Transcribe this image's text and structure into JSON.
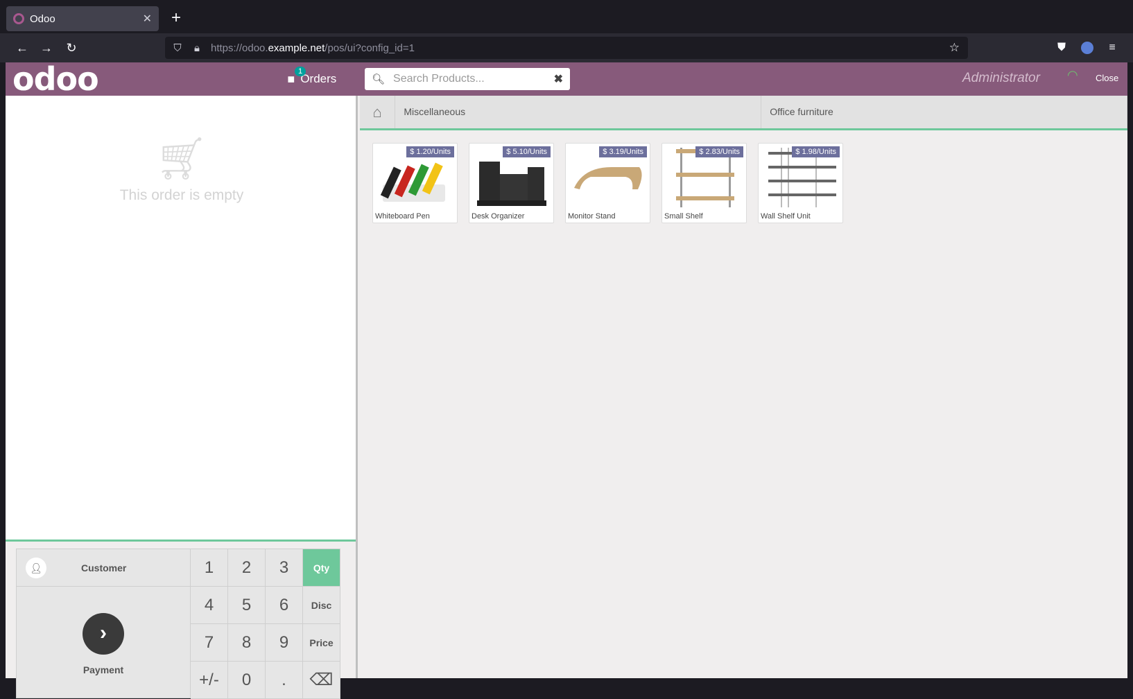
{
  "browser": {
    "tab_title": "Odoo",
    "url_prefix": "https://odoo.",
    "url_host": "example.net",
    "url_path": "/pos/ui?config_id=1"
  },
  "pos": {
    "logo": "odoo",
    "orders_label": "Orders",
    "orders_badge": "1",
    "search_placeholder": "Search Products...",
    "user": "Administrator",
    "close_label": "Close",
    "empty_text": "This order is empty",
    "customer_label": "Customer",
    "payment_label": "Payment",
    "keys": [
      "1",
      "2",
      "3",
      "Qty",
      "4",
      "5",
      "6",
      "Disc",
      "7",
      "8",
      "9",
      "Price",
      "+/-",
      "0",
      ".",
      "⌫"
    ],
    "active_mode": "Qty",
    "categories": [
      "Miscellaneous",
      "Office furniture"
    ],
    "products": [
      {
        "name": "Whiteboard Pen",
        "price": "$ 1.20/Units"
      },
      {
        "name": "Desk Organizer",
        "price": "$ 5.10/Units"
      },
      {
        "name": "Monitor Stand",
        "price": "$ 3.19/Units"
      },
      {
        "name": "Small Shelf",
        "price": "$ 2.83/Units"
      },
      {
        "name": "Wall Shelf Unit",
        "price": "$ 1.98/Units"
      }
    ],
    "colors": {
      "brand": "#875a7b",
      "accent": "#6ec89b",
      "price_badge": "#6c6f9c"
    }
  }
}
